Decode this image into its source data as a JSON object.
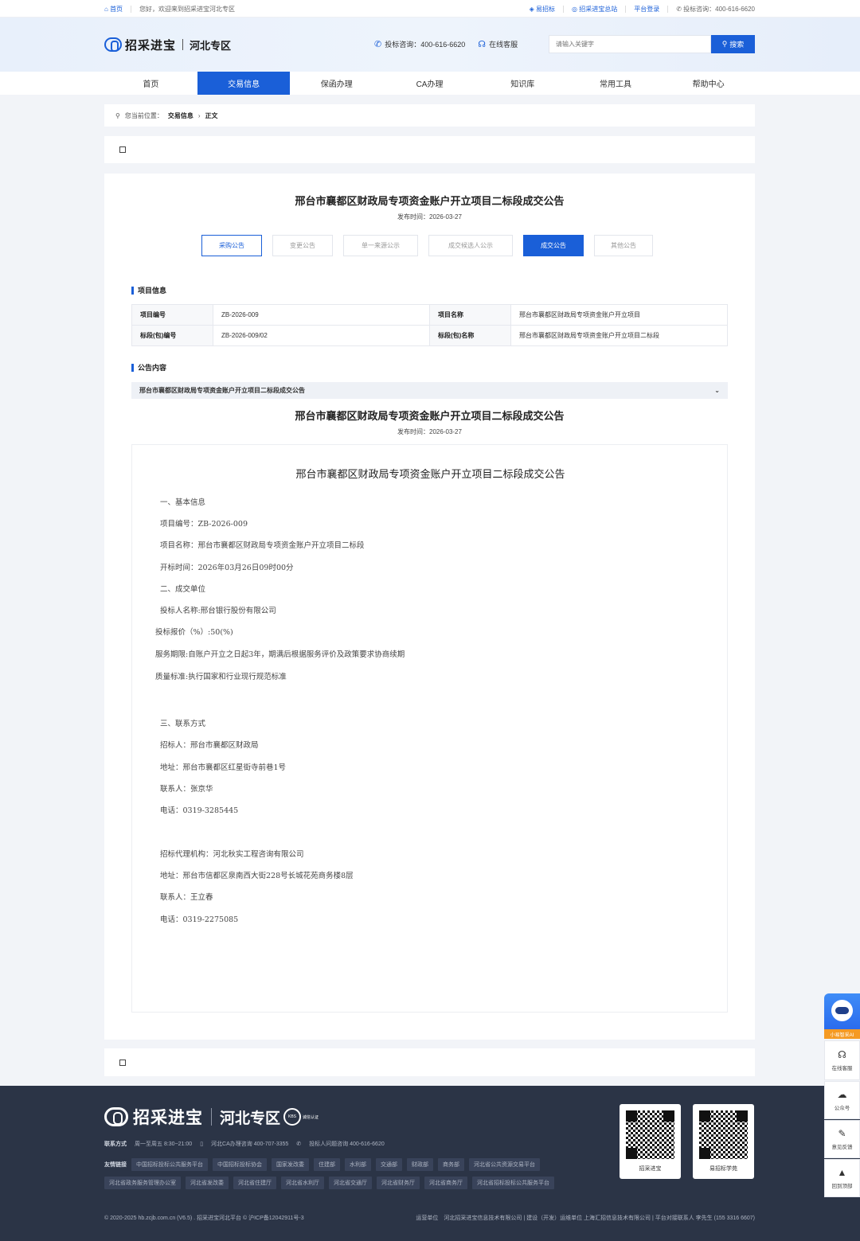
{
  "topbar": {
    "home": "首页",
    "welcome": "您好，欢迎来到招采进宝河北专区",
    "links": [
      "易招标",
      "招采进宝总站",
      "平台登录"
    ],
    "phone": "投标咨询：400-616-6620"
  },
  "header": {
    "logo_name": "招采进宝",
    "logo_zone": "河北专区",
    "consult": "投标咨询：400-616-6620",
    "service": "在线客服",
    "search_placeholder": "请输入关键字",
    "search_button": "搜索"
  },
  "nav": {
    "tabs": [
      "首页",
      "交易信息",
      "保函办理",
      "CA办理",
      "知识库",
      "常用工具",
      "帮助中心"
    ],
    "active": "交易信息"
  },
  "breadcrumb": {
    "prefix": "您当前位置：",
    "items": [
      "交易信息",
      "正文"
    ]
  },
  "announcement": {
    "title": "邢台市襄都区财政局专项资金账户开立项目二标段成交公告",
    "date": "发布时间：2026-03-27",
    "steps": [
      "采购公告",
      "变更公告",
      "单一来源公示",
      "成交候选人公示",
      "成交公告",
      "其他公告"
    ],
    "project_section": "项目信息",
    "project": {
      "code_label": "项目编号",
      "code": "ZB-2026-009",
      "name_label": "项目名称",
      "name": "邢台市襄都区财政局专项资金账户开立项目",
      "lot_code_label": "标段(包)编号",
      "lot_code": "ZB-2026-009/02",
      "lot_name_label": "标段(包)名称",
      "lot_name": "邢台市襄都区财政局专项资金账户开立项目二标段"
    },
    "content_section": "公告内容",
    "collapse_title": "邢台市襄都区财政局专项资金账户开立项目二标段成交公告",
    "body_title": "邢台市襄都区财政局专项资金账户开立项目二标段成交公告",
    "body_date": "发布时间：2026-03-27",
    "doc_title": "邢台市襄都区财政局专项资金账户开立项目二标段成交公告",
    "doc_lines": [
      "一、基本信息",
      "项目编号：ZB-2026-009",
      "项目名称：邢台市襄都区财政局专项资金账户开立项目二标段",
      "开标时间：2026年03月26日09时00分",
      "二、成交单位",
      "投标人名称:邢台银行股份有限公司",
      "投标报价（%）:50(%)",
      "服务期限:自账户开立之日起3年，期满后根据服务评价及政策要求协商续期",
      "质量标准:执行国家和行业现行规范标准",
      "三、联系方式",
      "招标人：邢台市襄都区财政局",
      "地址：邢台市襄都区红星街寺前巷1号",
      "联系人：张京华",
      "电话：0319-3285445",
      "招标代理机构：河北秋实工程咨询有限公司",
      "地址：邢台市信都区泉南西大街228号长城花苑商务楼8层",
      "联系人：王立春",
      "电话：0319-2275085"
    ]
  },
  "footer": {
    "logo_name": "招采进宝",
    "logo_zone": "河北专区",
    "seal_text": "KBS",
    "seal_caption": "诚信认证",
    "contact_label": "联系方式",
    "contact_items": [
      "周一至周五 8:30~21:00",
      "河北CA办理咨询 400-707-3355",
      "投标人问题咨询 400-616-6620"
    ],
    "links_label": "友情链接",
    "links_row1": [
      "中国招标投标公共服务平台",
      "中国招标投标协会",
      "国家发改委",
      "住建部",
      "水利部",
      "交通部",
      "财政部",
      "商务部",
      "河北省公共资源交易平台"
    ],
    "links_row2": [
      "河北省政务服务管理办公室",
      "河北省发改委",
      "河北省住建厅",
      "河北省水利厅",
      "河北省交通厅",
      "河北省财务厅",
      "河北省商务厅",
      "河北省招标投标公共服务平台"
    ],
    "qr_captions": [
      "招采进宝",
      "易招标学苑"
    ],
    "copyright": "© 2020-2025 hb.zcjb.com.cn (V6.5) . 招采进宝河北平台 ©  沪ICP备12042911号-3",
    "operator": "运营单位　河北招采进宝信息技术有限公司 | 建设（开发）运维单位 上海汇招信息技术有限公司 | 平台对接联系人  李先生 (155 3316 6607)"
  },
  "sidebar": {
    "ai_label": "小易智采AI",
    "items": [
      "在线客服",
      "公众号",
      "意见反馈",
      "回到顶部"
    ]
  },
  "colors": {
    "accent": "#1a5fd8",
    "footer_bg": "#2b3446",
    "ai_tag": "#f59a23"
  }
}
